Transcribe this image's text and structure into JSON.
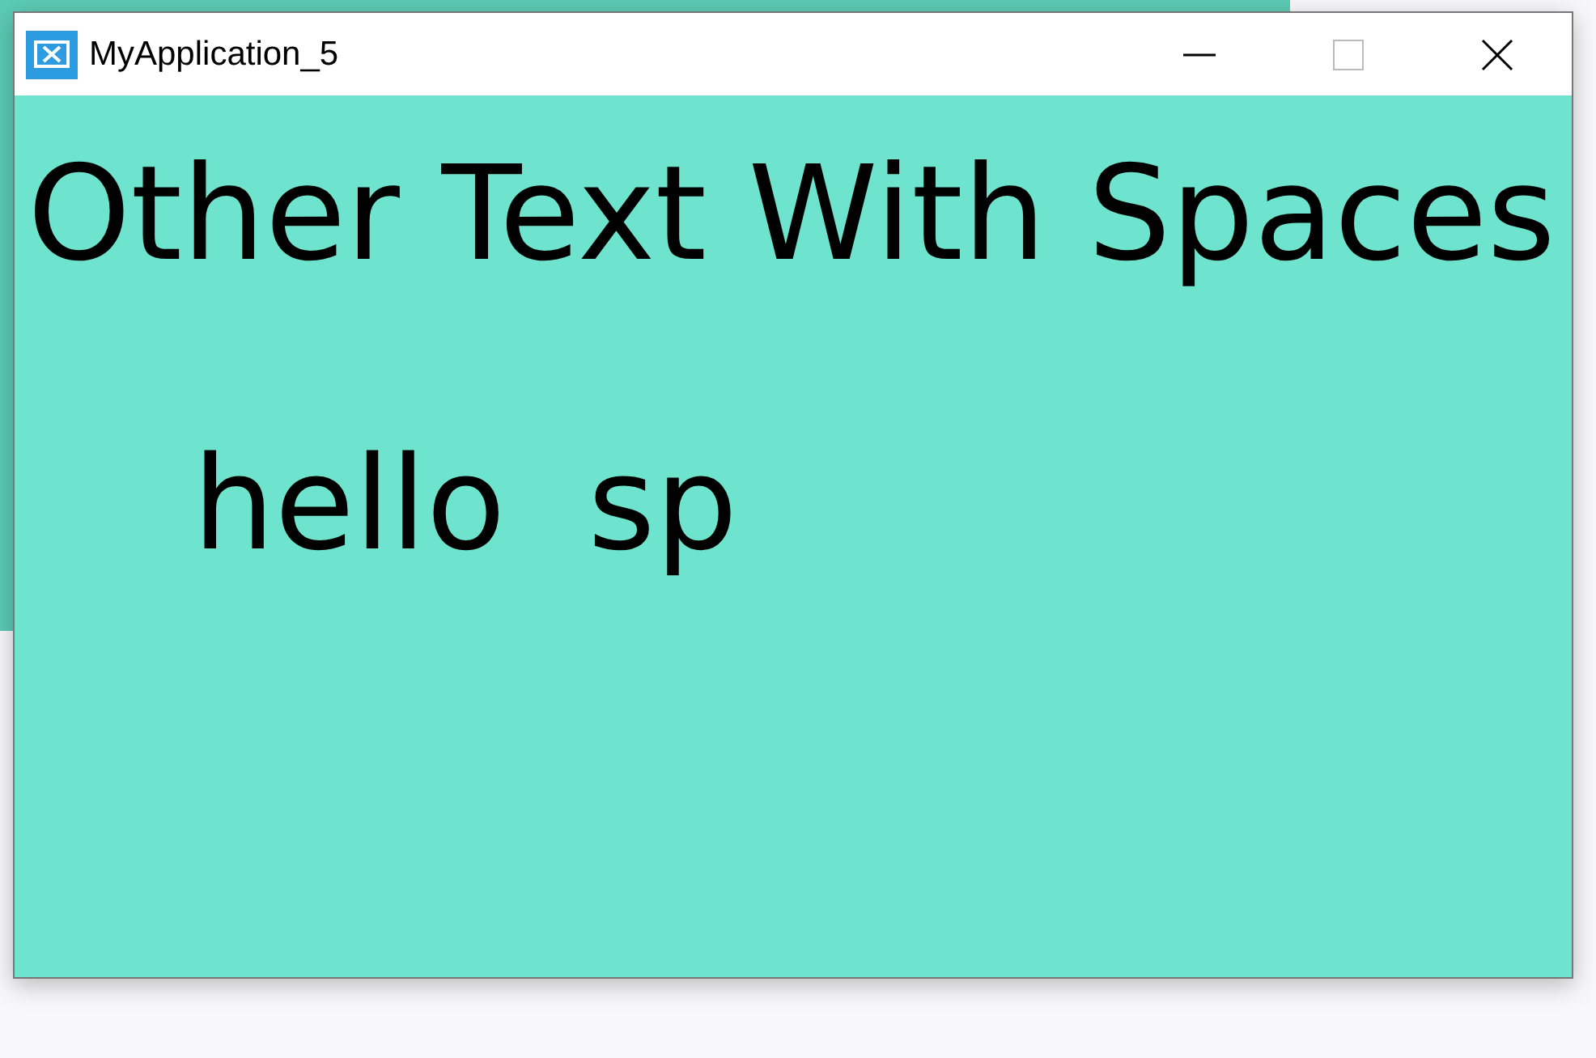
{
  "window": {
    "title": "MyApplication_5"
  },
  "content": {
    "heading": "Other Text With Spaces",
    "text": "hello  sp"
  }
}
